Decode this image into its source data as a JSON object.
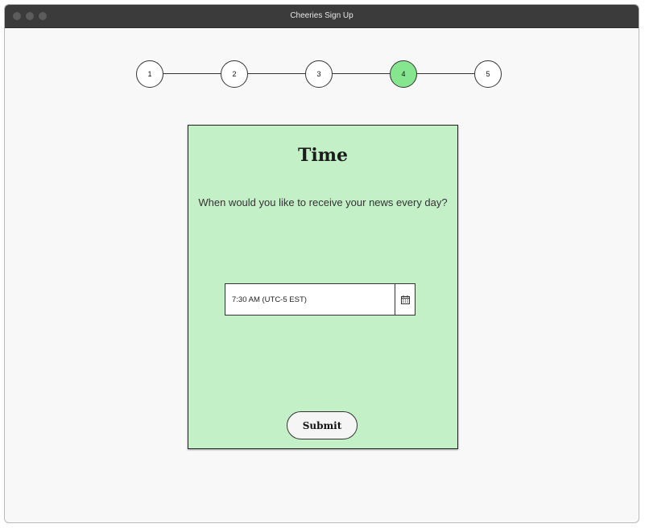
{
  "window": {
    "title": "Cheeries Sign Up"
  },
  "stepper": {
    "steps": [
      "1",
      "2",
      "3",
      "4",
      "5"
    ],
    "active_step": "4"
  },
  "card": {
    "title": "Time",
    "question": "When would you like to receive your news every day?",
    "time_field": {
      "value": "7:30 AM (UTC-5 EST)",
      "icon": "calendar-icon"
    },
    "submit_label": "Submit"
  },
  "colors": {
    "card_background": "#c4f0c8",
    "active_step": "#86e68f",
    "titlebar": "#3b3b3b"
  }
}
